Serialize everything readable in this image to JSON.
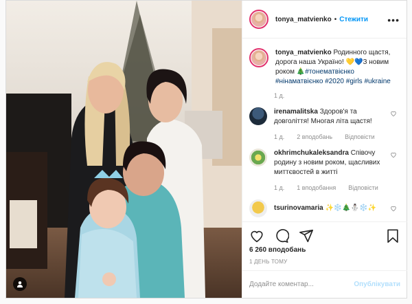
{
  "header": {
    "username": "tonya_matvienko",
    "separator": "•",
    "follow_label": "Стежити",
    "more_label": "•••"
  },
  "caption": {
    "username": "tonya_matvienko",
    "text_1": "Родинного щастя, дорога наша Україно!",
    "emoji_1": "💛💙",
    "text_2": "З новим роком",
    "emoji_2": "🎄",
    "tags": [
      "#тонематвієнко",
      "#нінаматвієнко",
      "#2020",
      "#girls",
      "#ukraine"
    ],
    "time": "1 д."
  },
  "comments": [
    {
      "username": "irenamalitska",
      "text": "Здоров'я та довголіття! Многая літа щастя!",
      "time": "1 д.",
      "likes": "2 вподобань",
      "reply": "Відповісти"
    },
    {
      "username": "okhrimchukaleksandra",
      "text": "Співочу родину з новим роком, щасливих миттєвостей в житті",
      "time": "1 д.",
      "likes": "1 вподобання",
      "reply": "Відповісти"
    },
    {
      "username": "tsurinovamaria",
      "text": "✨❄️🎄⛄❄️✨",
      "time": "",
      "likes": "",
      "reply": ""
    }
  ],
  "stats": {
    "likes": "6 260 вподобань",
    "when": "1 день тому"
  },
  "add_comment": {
    "placeholder": "Додайте коментар...",
    "post_label": "Опублікувати"
  },
  "icons": {
    "like": "heart-icon",
    "comment": "comment-icon",
    "share": "share-icon",
    "save": "bookmark-icon",
    "tag": "user-tag-icon",
    "more": "more-options-icon"
  },
  "colors": {
    "link": "#0095f6",
    "hashtag": "#00376b",
    "muted": "#8e8e8e",
    "border": "#dbdbdb",
    "post_disabled": "#b2dffc"
  }
}
